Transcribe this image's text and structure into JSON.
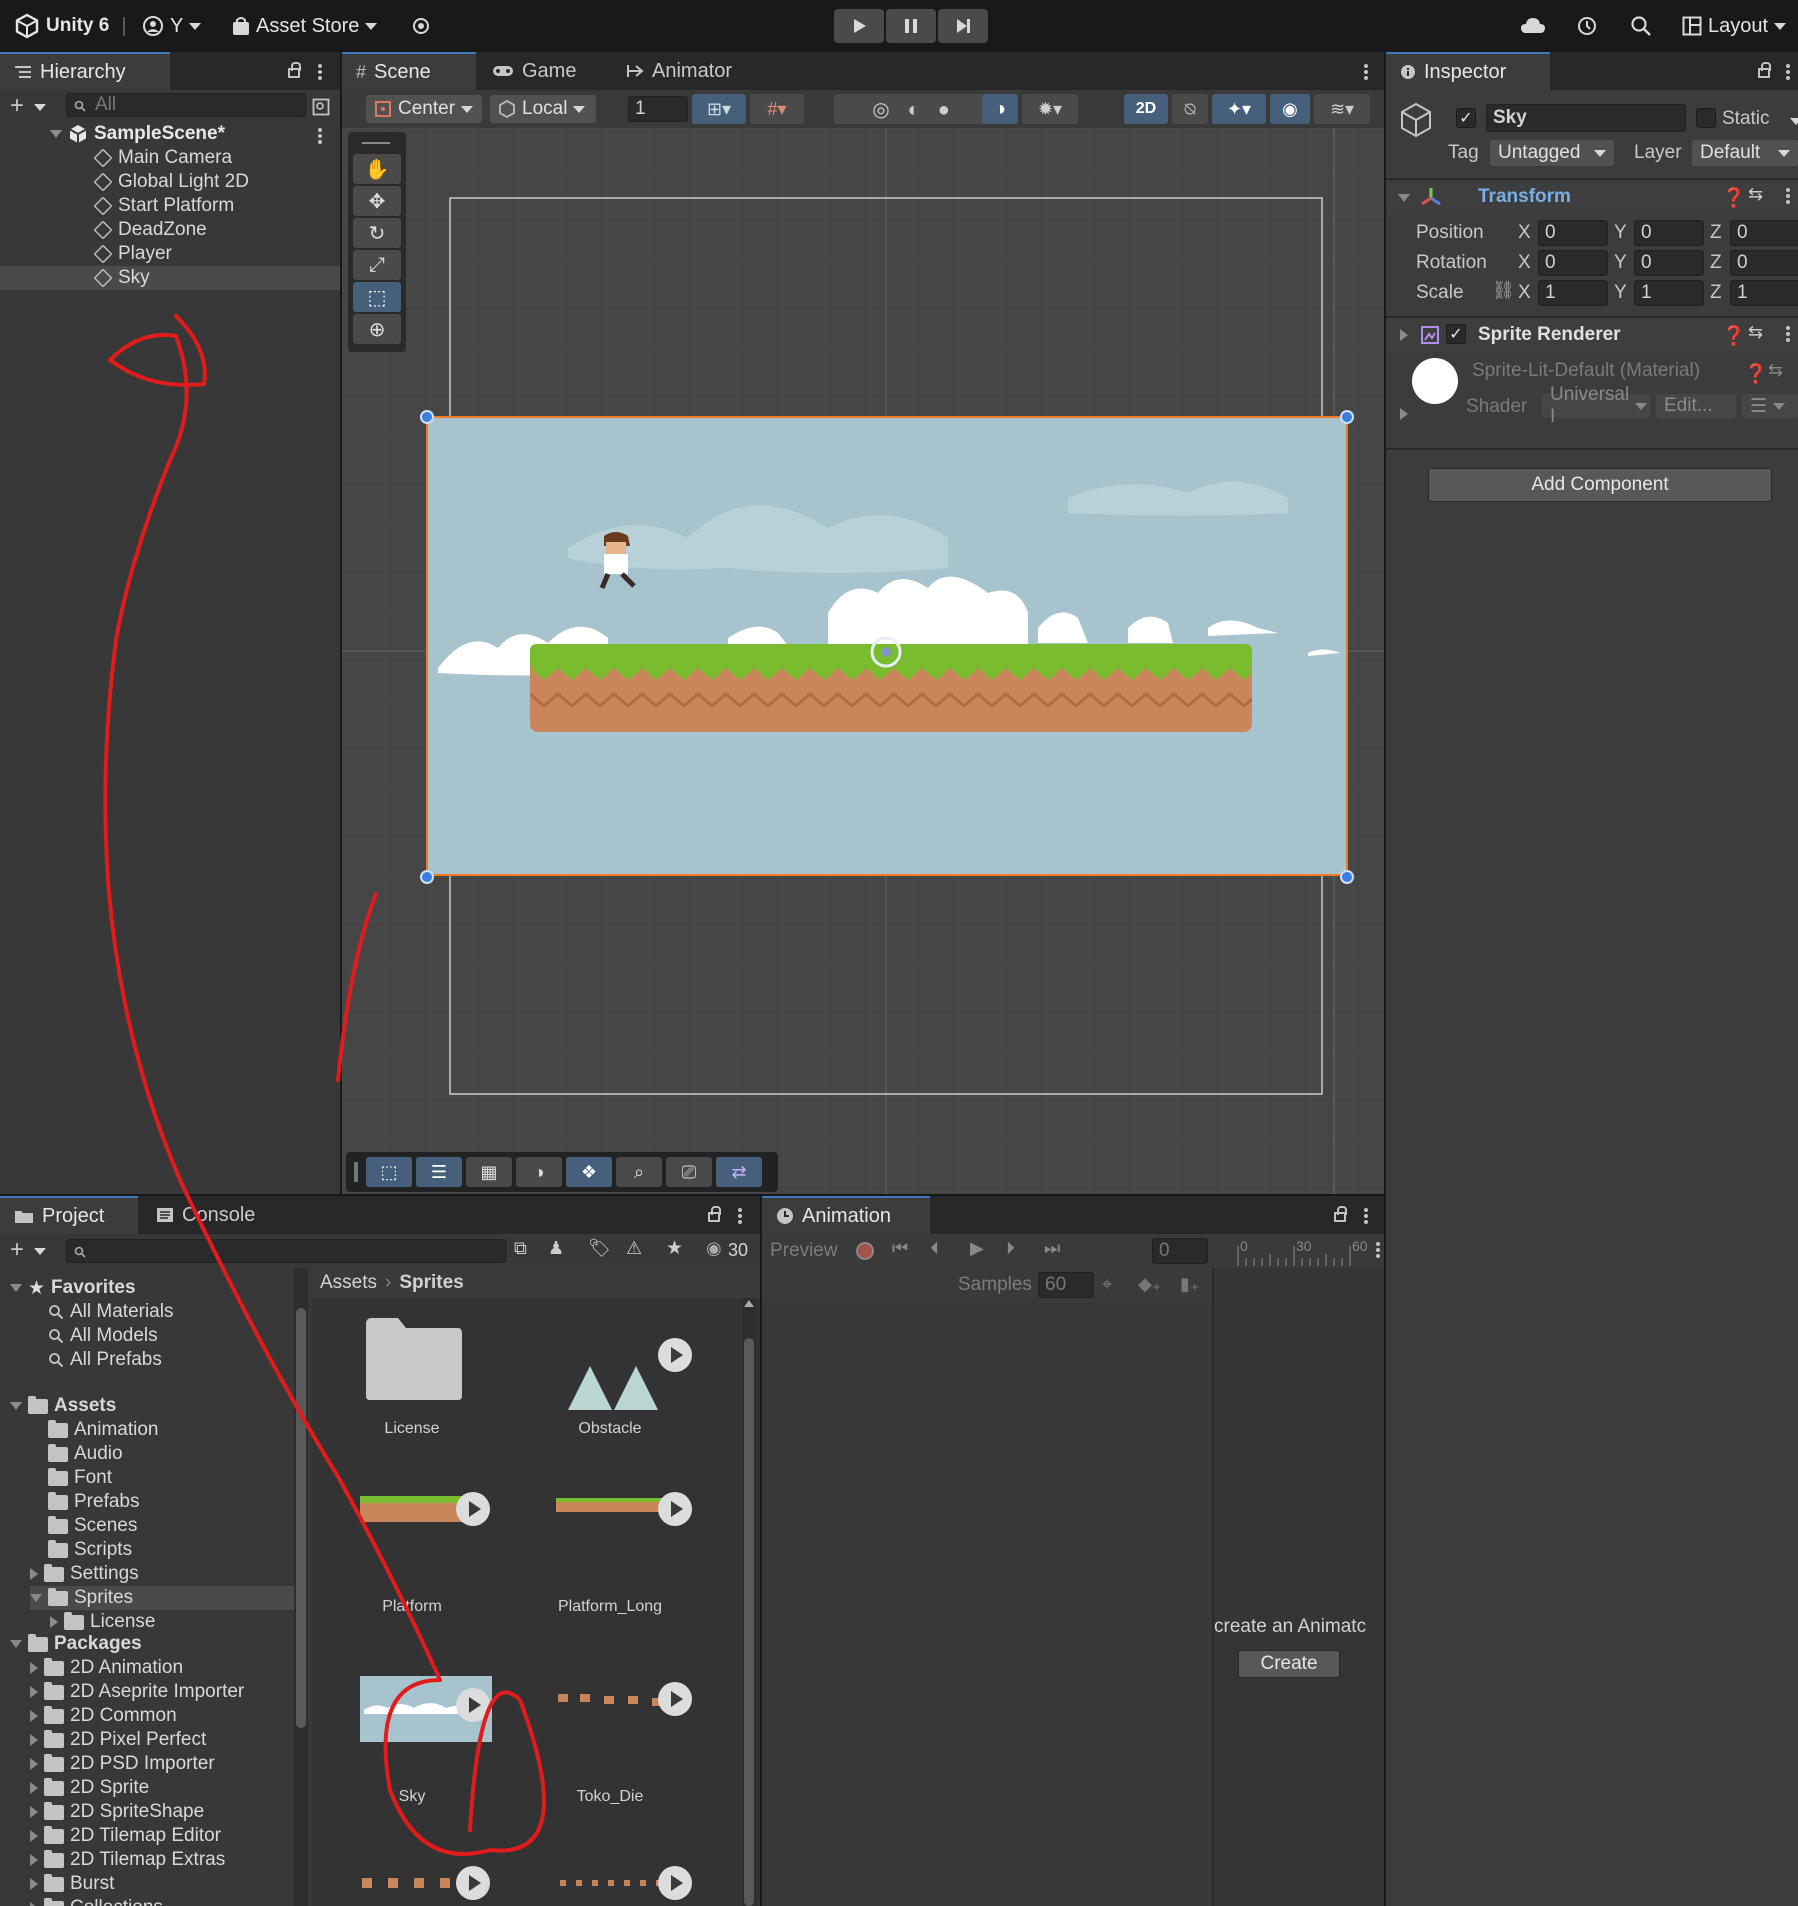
{
  "topbar": {
    "app_name": "Unity 6",
    "account_label": "Y",
    "asset_store_label": "Asset Store",
    "layout_label": "Layout"
  },
  "hierarchy": {
    "tab_label": "Hierarchy",
    "search_placeholder": "All",
    "scene_name": "SampleScene*",
    "items": [
      {
        "label": "Main Camera"
      },
      {
        "label": "Global Light 2D"
      },
      {
        "label": "Start Platform"
      },
      {
        "label": "DeadZone"
      },
      {
        "label": "Player"
      },
      {
        "label": "Sky",
        "selected": true
      }
    ]
  },
  "scene": {
    "tabs": [
      {
        "label": "Scene",
        "active": true
      },
      {
        "label": "Game"
      },
      {
        "label": "Animator"
      }
    ],
    "toolbar": {
      "pivot_label": "Center",
      "space_label": "Local",
      "grid_value": "1",
      "mode_2d_label": "2D"
    },
    "colors": {
      "sky": "#a6c3ce",
      "grass": "#79bd2e",
      "dirt": "#c8865a",
      "selection_outline": "#f07b22",
      "handle": "#3a7fe0"
    }
  },
  "inspector": {
    "tab_label": "Inspector",
    "object_name": "Sky",
    "static_label": "Static",
    "tag_label": "Tag",
    "tag_value": "Untagged",
    "layer_label": "Layer",
    "layer_value": "Default",
    "transform": {
      "title": "Transform",
      "position_label": "Position",
      "rotation_label": "Rotation",
      "scale_label": "Scale",
      "position": {
        "x": "0",
        "y": "0",
        "z": "0"
      },
      "rotation": {
        "x": "0",
        "y": "0",
        "z": "0"
      },
      "scale": {
        "x": "1",
        "y": "1",
        "z": "1"
      },
      "axis_x": "X",
      "axis_y": "Y",
      "axis_z": "Z"
    },
    "sprite_renderer": {
      "title": "Sprite Renderer",
      "material": "Sprite-Lit-Default (Material)",
      "shader_label": "Shader",
      "shader_value": "Universal I",
      "edit_label": "Edit..."
    },
    "add_component_label": "Add Component"
  },
  "project": {
    "tabs": [
      {
        "label": "Project",
        "active": true
      },
      {
        "label": "Console"
      }
    ],
    "visible_count": "30",
    "favorites_label": "Favorites",
    "favorites": [
      "All Materials",
      "All Models",
      "All Prefabs"
    ],
    "assets_label": "Assets",
    "asset_folders": [
      "Animation",
      "Audio",
      "Font",
      "Prefabs",
      "Scenes",
      "Scripts",
      "Settings",
      "Sprites",
      "License"
    ],
    "packages_label": "Packages",
    "packages": [
      "2D Animation",
      "2D Aseprite Importer",
      "2D Common",
      "2D Pixel Perfect",
      "2D PSD Importer",
      "2D Sprite",
      "2D SpriteShape",
      "2D Tilemap Editor",
      "2D Tilemap Extras",
      "Burst",
      "Collections"
    ],
    "breadcrumb_root": "Assets",
    "breadcrumb_current": "Sprites",
    "grid_items": [
      {
        "label": "License"
      },
      {
        "label": "Obstacle"
      },
      {
        "label": "Platform"
      },
      {
        "label": "Platform_Long"
      },
      {
        "label": "Sky"
      },
      {
        "label": "Toko_Die"
      }
    ]
  },
  "animation": {
    "tab_label": "Animation",
    "preview_label": "Preview",
    "frame_value": "0",
    "samples_label": "Samples",
    "samples_value": "60",
    "timeline_ticks": [
      "0",
      "30",
      "60"
    ],
    "create_prompt": "create an Animatc",
    "create_button": "Create"
  },
  "annotation": {
    "stroke_color": "#e21b1b"
  }
}
